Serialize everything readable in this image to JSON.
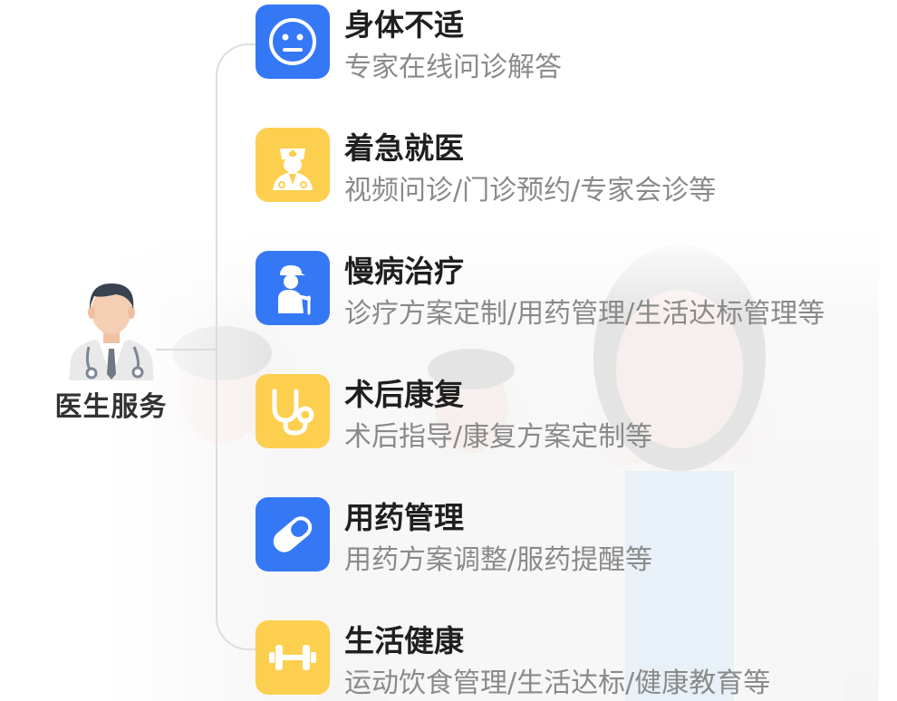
{
  "center": {
    "label": "医生服务",
    "icon": "doctor-avatar-icon"
  },
  "colors": {
    "blue_tile": "#3478f6",
    "yellow_tile": "#fccf4e",
    "title_text": "#1f1f1f",
    "desc_text": "#8a8a8a",
    "connector": "#dddddd"
  },
  "services": [
    {
      "title": "身体不适",
      "desc": "专家在线问诊解答",
      "icon": "neutral-face-icon",
      "tile_color": "blue"
    },
    {
      "title": "着急就医",
      "desc": "视频问诊/门诊预约/专家会诊等",
      "icon": "doctor-icon",
      "tile_color": "yellow"
    },
    {
      "title": "慢病治疗",
      "desc": "诊疗方案定制/用药管理/生活达标管理等",
      "icon": "elderly-person-icon",
      "tile_color": "blue"
    },
    {
      "title": "术后康复",
      "desc": "术后指导/康复方案定制等",
      "icon": "stethoscope-icon",
      "tile_color": "yellow"
    },
    {
      "title": "用药管理",
      "desc": "用药方案调整/服药提醒等",
      "icon": "pill-capsule-icon",
      "tile_color": "blue"
    },
    {
      "title": "生活健康",
      "desc": "运动饮食管理/生活达标/健康教育等",
      "icon": "dumbbell-icon",
      "tile_color": "yellow"
    }
  ]
}
